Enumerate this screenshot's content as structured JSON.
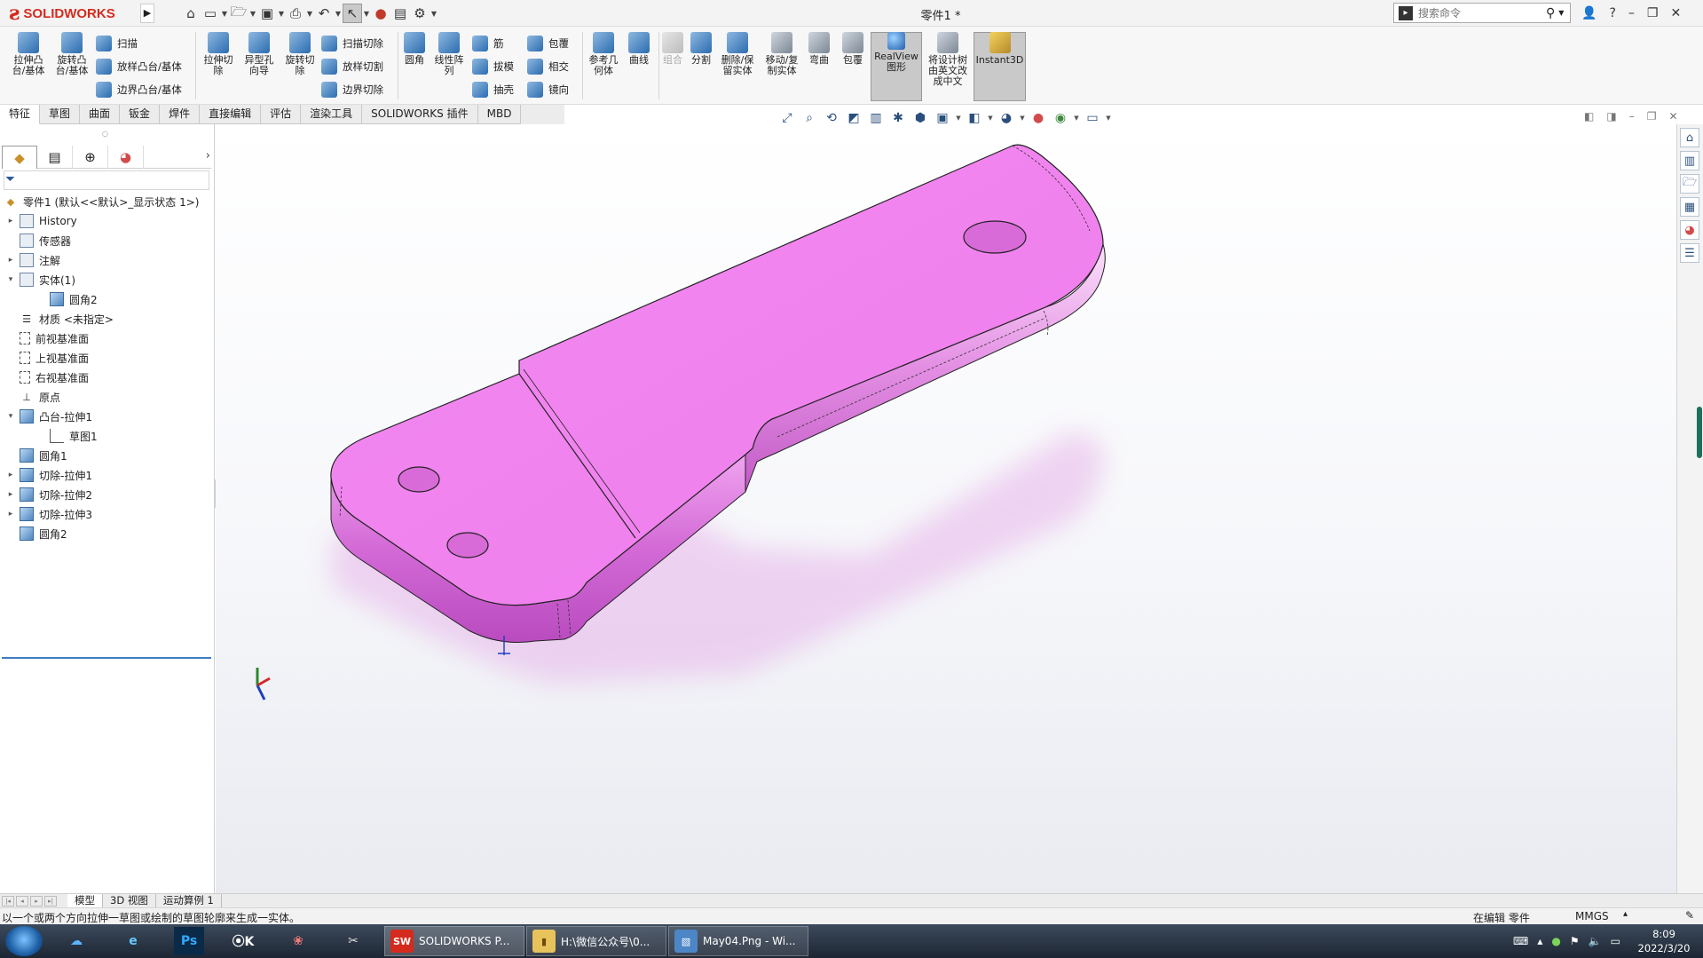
{
  "app": {
    "logo_text": "SOLIDWORKS",
    "doc_title": "零件1 *",
    "search_placeholder": "搜索命令"
  },
  "ribbon": {
    "extrude_boss": "拉伸凸\n台/基体",
    "revolve_boss": "旋转凸\n台/基体",
    "sweep": "扫描",
    "loft_boss": "放样凸台/基体",
    "boundary_boss": "边界凸台/基体",
    "extrude_cut": "拉伸切\n除",
    "hole_wizard": "异型孔\n向导",
    "revolve_cut": "旋转切\n除",
    "swept_cut": "扫描切除",
    "lofted_cut": "放样切割",
    "boundary_cut": "边界切除",
    "fillet": "圆角",
    "linear_pattern": "线性阵\n列",
    "rib": "筋",
    "draft": "拔模",
    "shell": "抽壳",
    "wrap": "包覆",
    "intersect": "相交",
    "mirror": "镜向",
    "ref_geometry": "参考几\n何体",
    "curves": "曲线",
    "combine": "组合",
    "split": "分割",
    "delete_keep_body": "删除/保\n留实体",
    "move_copy_body": "移动/复\n制实体",
    "flex": "弯曲",
    "wrap2": "包覆",
    "realview": "RealView\n图形",
    "translate_tree": "将设计树\n由英文改\n成中文",
    "instant3d": "Instant3D"
  },
  "tabs": [
    "特征",
    "草图",
    "曲面",
    "钣金",
    "焊件",
    "直接编辑",
    "评估",
    "渲染工具",
    "SOLIDWORKS 插件",
    "MBD"
  ],
  "tree": {
    "root": "零件1 (默认<<默认>_显示状态 1>)",
    "items": [
      {
        "label": "History",
        "indent": 1,
        "toggle": "▸",
        "icon": "folder"
      },
      {
        "label": "传感器",
        "indent": 1,
        "toggle": "",
        "icon": "folder"
      },
      {
        "label": "注解",
        "indent": 1,
        "toggle": "▸",
        "icon": "folder"
      },
      {
        "label": "实体(1)",
        "indent": 1,
        "toggle": "▾",
        "icon": "folder"
      },
      {
        "label": "圆角2",
        "indent": 2,
        "toggle": "",
        "icon": "cube"
      },
      {
        "label": "材质 <未指定>",
        "indent": 1,
        "toggle": "",
        "icon": "material"
      },
      {
        "label": "前视基准面",
        "indent": 1,
        "toggle": "",
        "icon": "plane"
      },
      {
        "label": "上视基准面",
        "indent": 1,
        "toggle": "",
        "icon": "plane"
      },
      {
        "label": "右视基准面",
        "indent": 1,
        "toggle": "",
        "icon": "plane"
      },
      {
        "label": "原点",
        "indent": 1,
        "toggle": "",
        "icon": "origin"
      },
      {
        "label": "凸台-拉伸1",
        "indent": 1,
        "toggle": "▾",
        "icon": "cube"
      },
      {
        "label": "草图1",
        "indent": 2,
        "toggle": "",
        "icon": "sketch"
      },
      {
        "label": "圆角1",
        "indent": 1,
        "toggle": "",
        "icon": "cube"
      },
      {
        "label": "切除-拉伸1",
        "indent": 1,
        "toggle": "▸",
        "icon": "cube"
      },
      {
        "label": "切除-拉伸2",
        "indent": 1,
        "toggle": "▸",
        "icon": "cube"
      },
      {
        "label": "切除-拉伸3",
        "indent": 1,
        "toggle": "▸",
        "icon": "cube"
      },
      {
        "label": "圆角2",
        "indent": 1,
        "toggle": "",
        "icon": "cube"
      }
    ]
  },
  "model_tabs": [
    "模型",
    "3D 视图",
    "运动算例 1"
  ],
  "status": {
    "message": "以一个或两个方向拉伸一草图或绘制的草图轮廓来生成一实体。",
    "editing": "在编辑 零件",
    "units": "MMGS"
  },
  "taskbar": {
    "apps": [
      {
        "label": "SOLIDWORKS P...",
        "active": true
      },
      {
        "label": "H:\\微信公众号\\0...",
        "active": false
      },
      {
        "label": "May04.Png - Wi...",
        "active": false
      }
    ],
    "time": "8:09",
    "date": "2022/3/20"
  },
  "colors": {
    "part": "#ef7bef",
    "brand": "#d52b1e"
  }
}
